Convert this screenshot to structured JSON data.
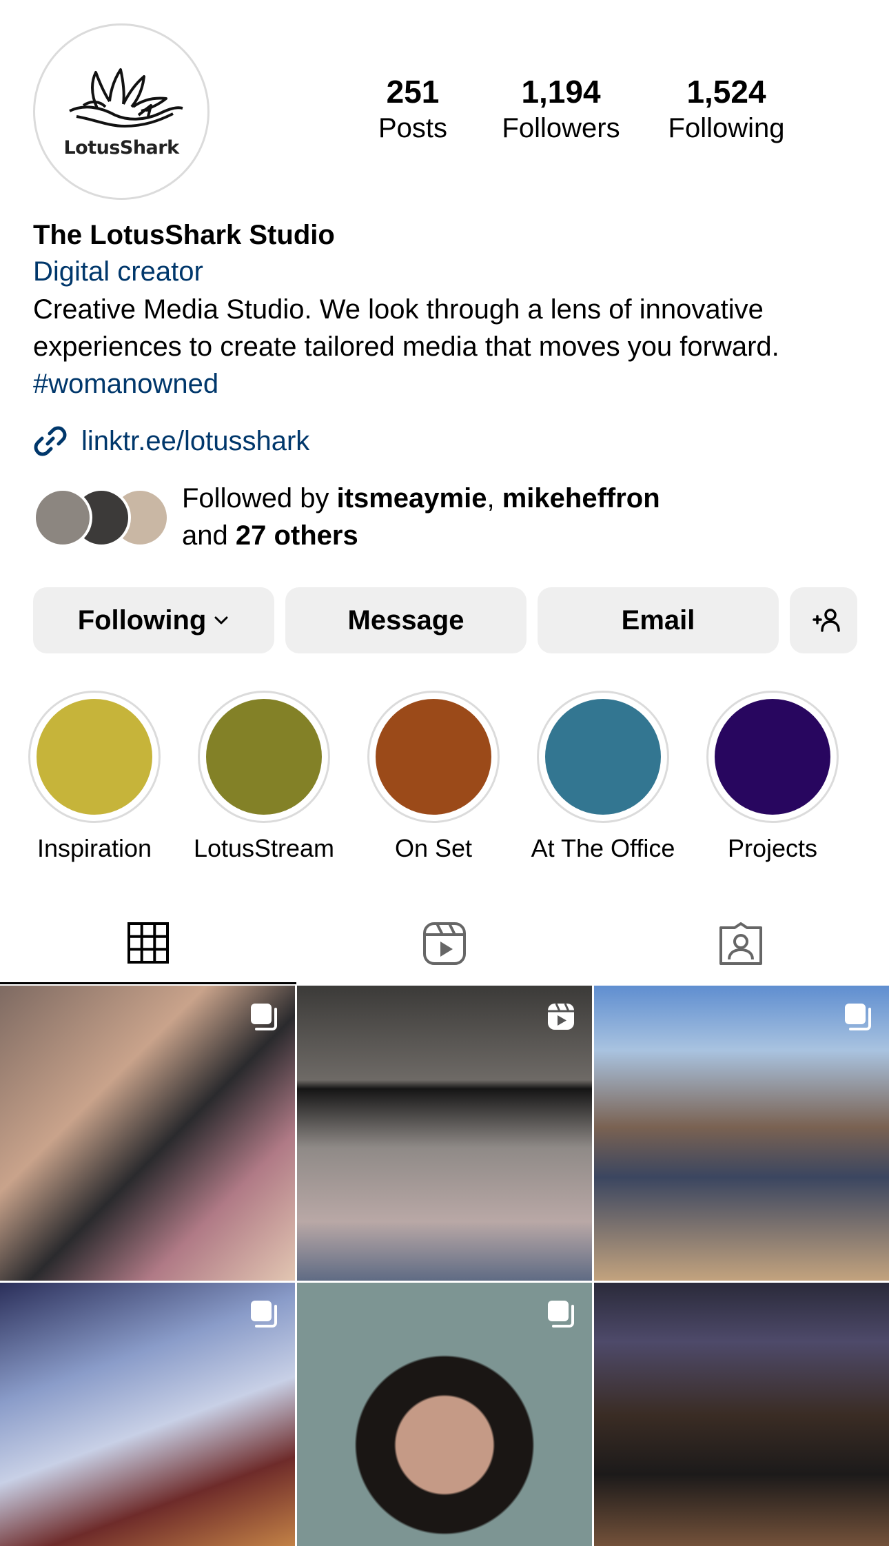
{
  "profile": {
    "avatar_text": "LotusShark",
    "name": "The LotusShark Studio",
    "category": "Digital creator",
    "bio_line1": "Creative Media Studio. We look through a lens of innovative",
    "bio_line2": "experiences to create tailored media that moves you forward.",
    "hashtag": "#womanowned",
    "link": "linktr.ee/lotusshark"
  },
  "stats": {
    "posts_count": "251",
    "posts_label": "Posts",
    "followers_count": "1,194",
    "followers_label": "Followers",
    "following_count": "1,524",
    "following_label": "Following"
  },
  "followed_by": {
    "prefix": "Followed by ",
    "user1": "itsmeaymie",
    "sep": ", ",
    "user2": "mikeheffron",
    "and": "and ",
    "others": "27 others"
  },
  "buttons": {
    "following": "Following",
    "message": "Message",
    "email": "Email"
  },
  "highlights": [
    {
      "label": "Inspiration",
      "color": "#c6b43a"
    },
    {
      "label": "LotusStream",
      "color": "#838127"
    },
    {
      "label": "On Set",
      "color": "#9b4a19"
    },
    {
      "label": "At The Office",
      "color": "#337691"
    },
    {
      "label": "Projects",
      "color": "#28065f"
    }
  ],
  "tabs": [
    "grid-tab",
    "reels-tab",
    "tagged-tab"
  ],
  "posts": [
    {
      "type": "carousel",
      "color": "#9a7a66"
    },
    {
      "type": "reel",
      "color": "#5e5b5a"
    },
    {
      "type": "carousel",
      "color": "#8fa0ad"
    },
    {
      "type": "carousel",
      "color": "#6e7fa6"
    },
    {
      "type": "carousel",
      "color": "#8e9c98"
    },
    {
      "type": "none",
      "color": "#6a5a4e"
    }
  ]
}
